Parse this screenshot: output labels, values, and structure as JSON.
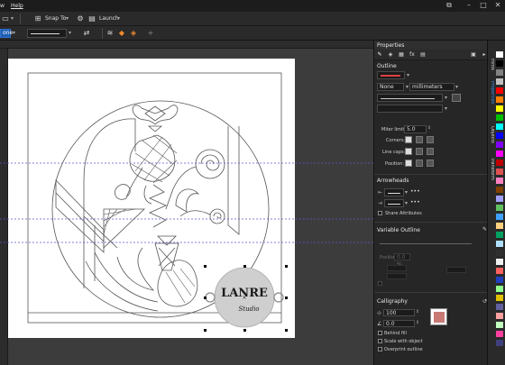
{
  "menubar": {
    "item_partial": "w",
    "help": "Help"
  },
  "toolbar1": {
    "snap_to": "Snap To",
    "launch": "Launch"
  },
  "toolbar2": {
    "fill_value": "one"
  },
  "properties": {
    "title": "Properties",
    "outline": {
      "title": "Outline",
      "width_value": "None",
      "units_value": "millimeters",
      "miter_limit_label": "Miter limit:",
      "miter_limit_value": "5.0",
      "corners_label": "Corners:",
      "line_caps_label": "Line caps:",
      "position_label": "Position:"
    },
    "arrowheads": {
      "title": "Arrowheads",
      "share_attributes": "Share Attributes"
    },
    "variable_outline": {
      "title": "Variable Outline",
      "position_label": "Position:",
      "position_value": "0.0 %"
    },
    "calligraphy": {
      "title": "Calligraphy",
      "stretch_value": "100",
      "angle_value": "0.0",
      "behind_fill": "Behind fill",
      "scale_with_object": "Scale with object",
      "overprint_outline": "Overprint outline"
    }
  },
  "logo": {
    "text": "LANRE",
    "subtext": "Studio"
  },
  "side_tabs": [
    "Hints",
    "Properties",
    "Objects",
    "Transform"
  ],
  "colors": {
    "accent": "#3b8df0",
    "calligraphy_swatch": "#c97a74",
    "palette": [
      "#ffffff",
      "#000000",
      "#808080",
      "#c0c0c0",
      "#ff0000",
      "#ff8000",
      "#ffff00",
      "#00c000",
      "#00ffff",
      "#0000ff",
      "#8000ff",
      "#ff00ff",
      "#c00000",
      "#e05050",
      "#ff80c0",
      "#804000",
      "#a0a0ff",
      "#60c060",
      "#40a0ff",
      "#ffd080",
      "#00a060",
      "#b0e0ff",
      "#303030",
      "#f0f0f0",
      "#ff6060",
      "#2040c0",
      "#90ff90",
      "#e0c000",
      "#6060a0",
      "#ffa0a0",
      "#c0ffc0",
      "#ff40a0",
      "#404080"
    ]
  }
}
